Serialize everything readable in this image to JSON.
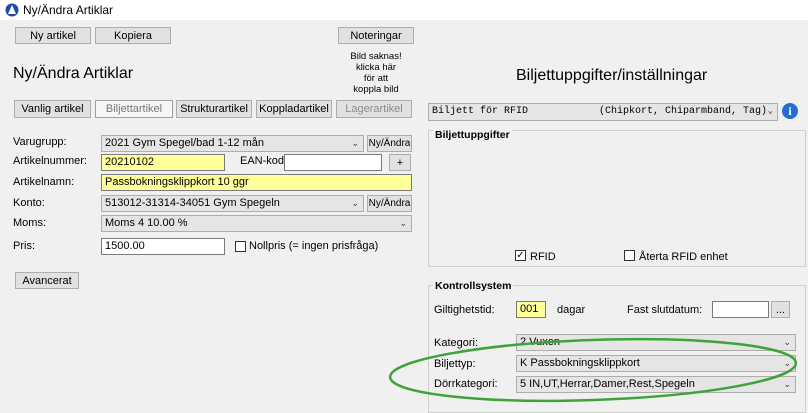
{
  "window": {
    "title": "Ny/Ändra Artiklar"
  },
  "toolbar": {
    "new_article": "Ny artikel",
    "copy": "Kopiera",
    "notes": "Noteringar"
  },
  "image_note": [
    "Bild saknas!",
    "klicka här",
    "för att",
    "koppla bild"
  ],
  "left_heading": "Ny/Ändra Artiklar",
  "right_heading": "Biljettuppgifter/inställningar",
  "tabs": [
    {
      "label": "Vanlig artikel"
    },
    {
      "label": "Biljettartikel"
    },
    {
      "label": "Strukturartikel"
    },
    {
      "label": "Koppladartikel"
    },
    {
      "label": "Lagerartikel"
    }
  ],
  "form": {
    "varugrupp": {
      "label": "Varugrupp:",
      "value": "2021 Gym Spegel/bad 1-12 mån",
      "button": "Ny/Ändra"
    },
    "artikelnummer": {
      "label": "Artikelnummer:",
      "value": "20210102"
    },
    "ean": {
      "label": "EAN-kod",
      "value": "",
      "button": "+"
    },
    "artikelnamn": {
      "label": "Artikelnamn:",
      "value": "Passbokningsklippkort 10 ggr"
    },
    "konto": {
      "label": "Konto:",
      "value": "513012-31314-34051 Gym Spegeln",
      "button": "Ny/Ändra"
    },
    "moms": {
      "label": "Moms:",
      "value": "Moms 4  10.00 %"
    },
    "pris": {
      "label": "Pris:",
      "value": "1500.00"
    },
    "nollpris": {
      "label": "Nollpris (= ingen prisfråga)",
      "checked": false
    },
    "advanced_button": "Avancerat"
  },
  "ticket": {
    "type_select": {
      "name": "Biljett för RFID",
      "desc": "(Chipkort, Chiparmband, Tag)"
    },
    "group_title": "Biljettuppgifter",
    "rfid": {
      "label": "RFID",
      "checked": true
    },
    "return_rfid": {
      "label": "Återta RFID enhet",
      "checked": false
    }
  },
  "control": {
    "group_title": "Kontrollsystem",
    "validity": {
      "label": "Giltighetstid:",
      "value": "001",
      "unit": "dagar"
    },
    "end_date": {
      "label": "Fast slutdatum:",
      "value": "",
      "button": "..."
    },
    "kategori": {
      "label": "Kategori:",
      "value": "2 Vuxen"
    },
    "biljettyp": {
      "label": "Biljettyp:",
      "value": "K Passbokningsklippkort"
    },
    "dorrkategori": {
      "label": "Dörrkategori:",
      "value": "5 IN,UT,Herrar,Damer,Rest,Spegeln"
    }
  },
  "colors": {
    "highlight_yellow": "#ffff99",
    "annotation_ellipse": "#3ea33a",
    "info_blue": "#1f6fd6"
  }
}
